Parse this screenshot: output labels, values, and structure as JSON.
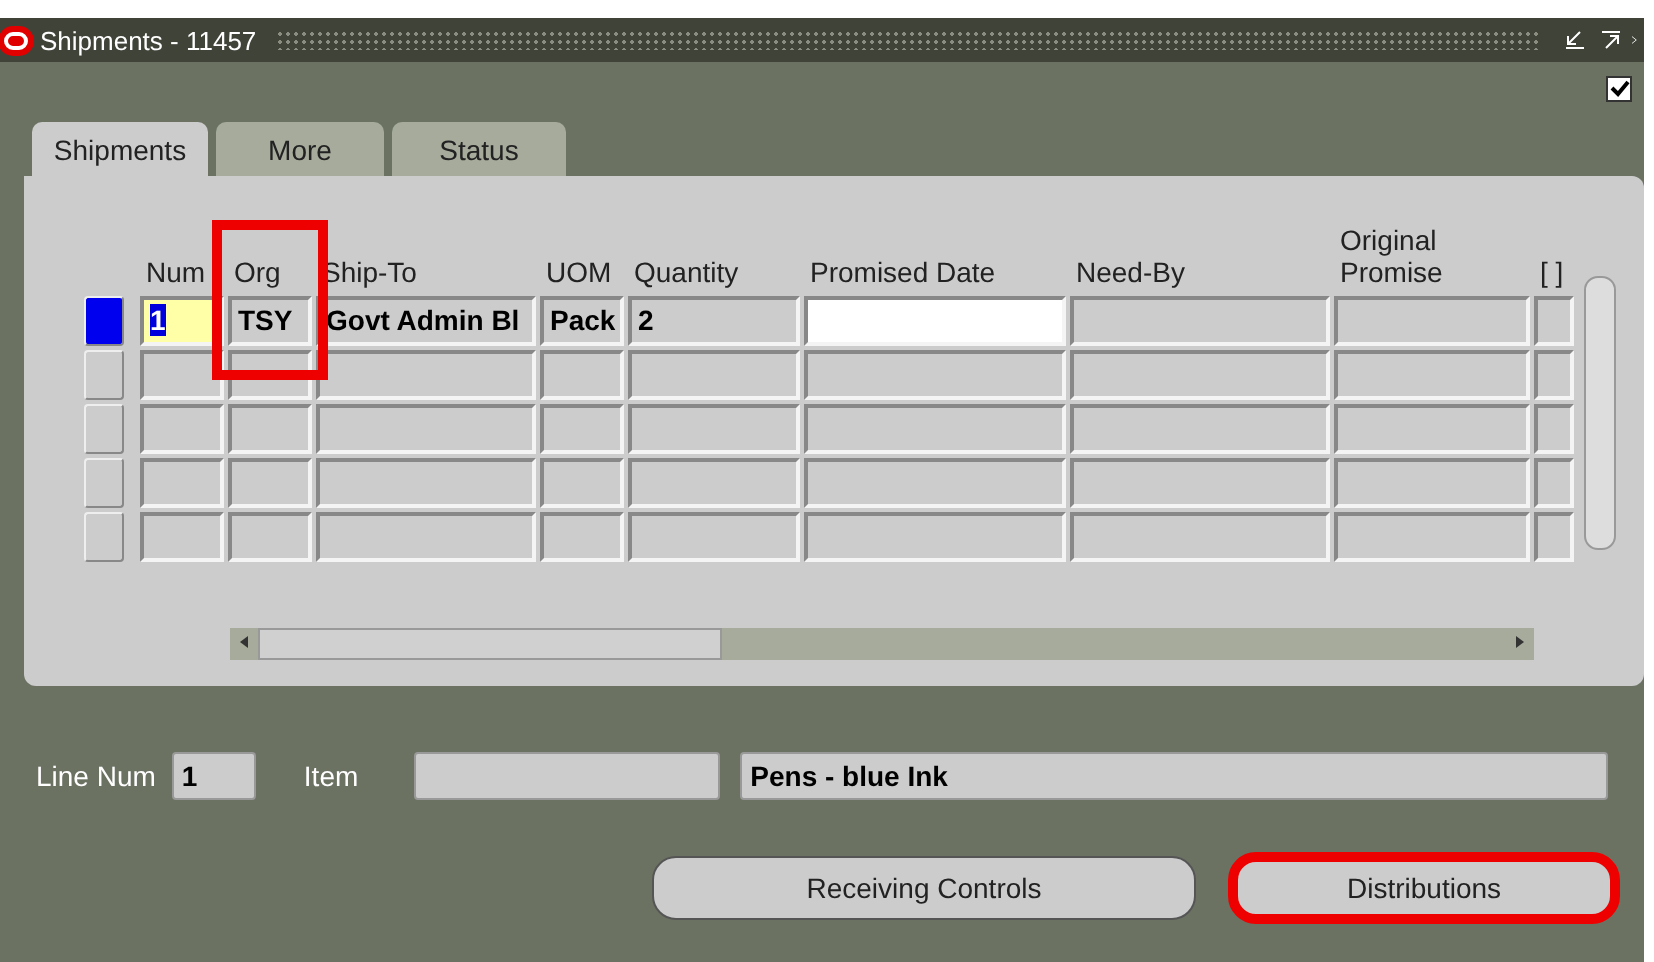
{
  "window": {
    "title": "Shipments - 11457",
    "checkbox_checked": true
  },
  "tabs": [
    {
      "label": "Shipments",
      "selected": true
    },
    {
      "label": "More",
      "selected": false
    },
    {
      "label": "Status",
      "selected": false
    }
  ],
  "table": {
    "columns": [
      {
        "label": "Num",
        "kind": "current",
        "highlighted": false
      },
      {
        "label": "Org",
        "kind": "plain",
        "highlighted": true
      },
      {
        "label": "Ship-To",
        "kind": "plain",
        "highlighted": false
      },
      {
        "label": "UOM",
        "kind": "plain",
        "highlighted": false
      },
      {
        "label": "Quantity",
        "kind": "plain",
        "highlighted": false
      },
      {
        "label": "Promised Date",
        "kind": "required",
        "highlighted": false
      },
      {
        "label": "Need-By",
        "kind": "plain",
        "highlighted": false
      },
      {
        "label": "Original Promise",
        "kind": "plain",
        "highlighted": false
      },
      {
        "label": "[ ]",
        "kind": "plain",
        "highlighted": false
      }
    ],
    "rows": [
      {
        "selected": true,
        "cells": [
          "1",
          "TSY",
          "Govt Admin Bl",
          "Pack",
          "2",
          "",
          "",
          "",
          ""
        ]
      },
      {
        "selected": false,
        "cells": [
          "",
          "",
          "",
          "",
          "",
          "",
          "",
          "",
          ""
        ]
      },
      {
        "selected": false,
        "cells": [
          "",
          "",
          "",
          "",
          "",
          "",
          "",
          "",
          ""
        ]
      },
      {
        "selected": false,
        "cells": [
          "",
          "",
          "",
          "",
          "",
          "",
          "",
          "",
          ""
        ]
      },
      {
        "selected": false,
        "cells": [
          "",
          "",
          "",
          "",
          "",
          "",
          "",
          "",
          ""
        ]
      }
    ]
  },
  "line": {
    "line_num_label": "Line Num",
    "line_num": "1",
    "item_label": "Item",
    "description": "Pens - blue Ink"
  },
  "buttons": [
    {
      "label": "Receiving Controls",
      "highlighted": false
    },
    {
      "label": "Distributions",
      "highlighted": true
    }
  ]
}
